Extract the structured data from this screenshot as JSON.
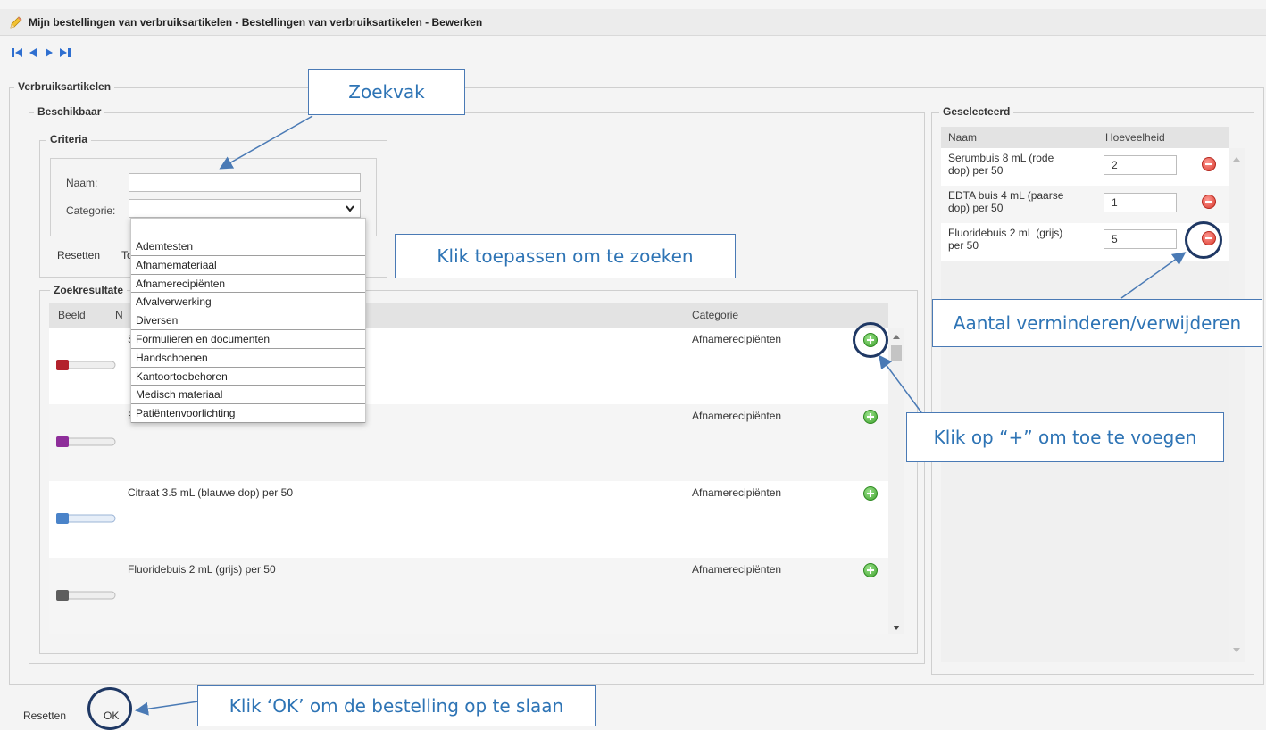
{
  "window": {
    "title": "Mijn bestellingen van verbruiksartikelen - Bestellingen van verbruiksartikelen - Bewerken"
  },
  "sections": {
    "verbruiksartikelen": "Verbruiksartikelen",
    "beschikbaar": "Beschikbaar",
    "criteria": "Criteria",
    "zoekresultaten": "Zoekresultate",
    "geselecteerd": "Geselecteerd"
  },
  "criteria": {
    "naam_label": "Naam:",
    "categorie_label": "Categorie:",
    "naam_value": "",
    "reset_label": "Resetten",
    "apply_label_partial": "To"
  },
  "category_options": [
    "Ademtesten",
    "Afnamemateriaal",
    "Afnamerecipiënten",
    "Afvalverwerking",
    "Diversen",
    "Formulieren en documenten",
    "Handschoenen",
    "Kantoortoebehoren",
    "Medisch materiaal",
    "Patiëntenvoorlichting"
  ],
  "results": {
    "headers": {
      "image": "Beeld",
      "name": "N",
      "category": "Categorie"
    },
    "rows": [
      {
        "name": "S",
        "category": "Afnamerecipiënten",
        "color": "#b3222c"
      },
      {
        "name": "E",
        "category": "Afnamerecipiënten",
        "color": "#8e2e9a"
      },
      {
        "name": "Citraat 3.5 mL (blauwe dop) per 50",
        "category": "Afnamerecipiënten",
        "color": "#4a83c9"
      },
      {
        "name": "Fluoridebuis 2 mL (grijs) per 50",
        "category": "Afnamerecipiënten",
        "color": "#5d5d5d"
      }
    ]
  },
  "selected": {
    "headers": {
      "name": "Naam",
      "quantity": "Hoeveelheid"
    },
    "rows": [
      {
        "name_line1": "Serumbuis 8 mL (rode",
        "name_line2": "dop) per 50",
        "quantity": "2"
      },
      {
        "name_line1": "EDTA buis 4 mL (paarse",
        "name_line2": "dop) per 50",
        "quantity": "1"
      },
      {
        "name_line1": "Fluoridebuis 2 mL (grijs)",
        "name_line2": "per 50",
        "quantity": "5"
      }
    ]
  },
  "footer": {
    "reset_label": "Resetten",
    "ok_label": "OK"
  },
  "callouts": {
    "search_box": "Zoekvak",
    "apply": "Klik toepassen om te zoeken",
    "decrease": "Aantal verminderen/verwijderen",
    "add": "Klik op “+” om toe te voegen",
    "ok": "Klik ‘OK’ om de bestelling op te slaan"
  },
  "colors": {
    "accent": "#2e74b5",
    "ring": "#1f3864",
    "nav_blue": "#2f6fd0"
  },
  "icons": [
    "pencil-icon",
    "first-record-icon",
    "previous-record-icon",
    "next-record-icon",
    "last-record-icon",
    "add-icon",
    "remove-icon",
    "select-chevron-icon"
  ]
}
